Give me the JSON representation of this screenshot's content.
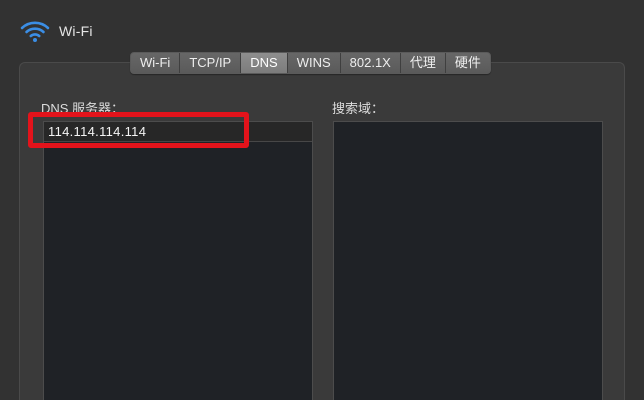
{
  "header": {
    "title": "Wi-Fi",
    "icon": "wifi-icon"
  },
  "tabs": [
    {
      "label": "Wi-Fi",
      "active": false
    },
    {
      "label": "TCP/IP",
      "active": false
    },
    {
      "label": "DNS",
      "active": true
    },
    {
      "label": "WINS",
      "active": false
    },
    {
      "label": "802.1X",
      "active": false
    },
    {
      "label": "代理",
      "active": false
    },
    {
      "label": "硬件",
      "active": false
    }
  ],
  "dns": {
    "label": "DNS 服务器：",
    "servers": [
      "114.114.114.114"
    ]
  },
  "search": {
    "label": "搜索域："
  },
  "colors": {
    "highlight": "#e3131b",
    "wifi_icon": "#3b8ee5",
    "active_tab": "#858585"
  }
}
